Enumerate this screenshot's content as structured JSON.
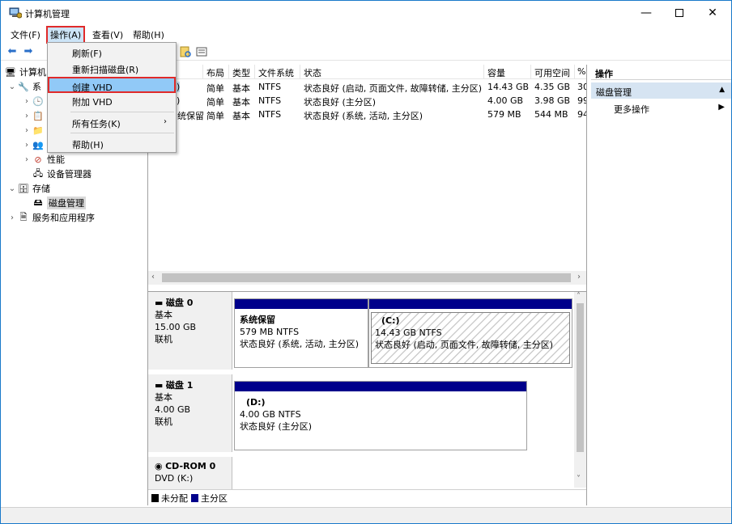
{
  "window": {
    "title": "计算机管理",
    "controls": {
      "minimize": "—",
      "close": "✕"
    }
  },
  "menubar": {
    "items": [
      "文件(F)",
      "操作(A)",
      "查看(V)",
      "帮助(H)"
    ]
  },
  "dropdown": {
    "items": [
      "刷新(F)",
      "重新扫描磁盘(R)",
      "创建 VHD",
      "附加 VHD",
      "所有任务(K)",
      "帮助(H)"
    ]
  },
  "tree": {
    "root": "计算机",
    "system_tools": "系",
    "performance": "性能",
    "device_manager": "设备管理器",
    "storage": "存储",
    "disk_management": "磁盘管理",
    "services": "服务和应用程序"
  },
  "volume_table": {
    "columns": [
      "布局",
      "类型",
      "文件系统",
      "状态",
      "容量",
      "可用空间",
      "%"
    ],
    "rows": [
      {
        "name": ")",
        "layout": "简单",
        "type": "基本",
        "fs": "NTFS",
        "status": "状态良好 (启动, 页面文件, 故障转储, 主分区)",
        "capacity": "14.43 GB",
        "free": "4.35 GB",
        "pct": "30"
      },
      {
        "name": ")",
        "layout": "简单",
        "type": "基本",
        "fs": "NTFS",
        "status": "状态良好 (主分区)",
        "capacity": "4.00 GB",
        "free": "3.98 GB",
        "pct": "99"
      },
      {
        "name": "统保留",
        "layout": "简单",
        "type": "基本",
        "fs": "NTFS",
        "status": "状态良好 (系统, 活动, 主分区)",
        "capacity": "579 MB",
        "free": "544 MB",
        "pct": "94"
      }
    ]
  },
  "disks": [
    {
      "name": "磁盘 0",
      "type": "基本",
      "size": "15.00 GB",
      "state": "联机",
      "partitions": [
        {
          "name": "系统保留",
          "size": "579 MB NTFS",
          "status": "状态良好 (系统, 活动, 主分区)"
        },
        {
          "name": "(C:)",
          "size": "14.43 GB NTFS",
          "status": "状态良好 (启动, 页面文件, 故障转储, 主分区)"
        }
      ]
    },
    {
      "name": "磁盘 1",
      "type": "基本",
      "size": "4.00 GB",
      "state": "联机",
      "partitions": [
        {
          "name": "(D:)",
          "size": "4.00 GB NTFS",
          "status": "状态良好 (主分区)"
        }
      ]
    },
    {
      "name": "CD-ROM 0",
      "type": "DVD (K:)"
    }
  ],
  "legend": {
    "unallocated": "未分配",
    "primary": "主分区",
    "unallocated_color": "#000000",
    "primary_color": "#00008b"
  },
  "actions_pane": {
    "header": "操作",
    "section": "磁盘管理",
    "more": "更多操作"
  },
  "colors": {
    "highlight_border": "#e02a2a",
    "selection": "#91c9f7",
    "partition_bar": "#00008b",
    "window_border": "#1979ca"
  }
}
